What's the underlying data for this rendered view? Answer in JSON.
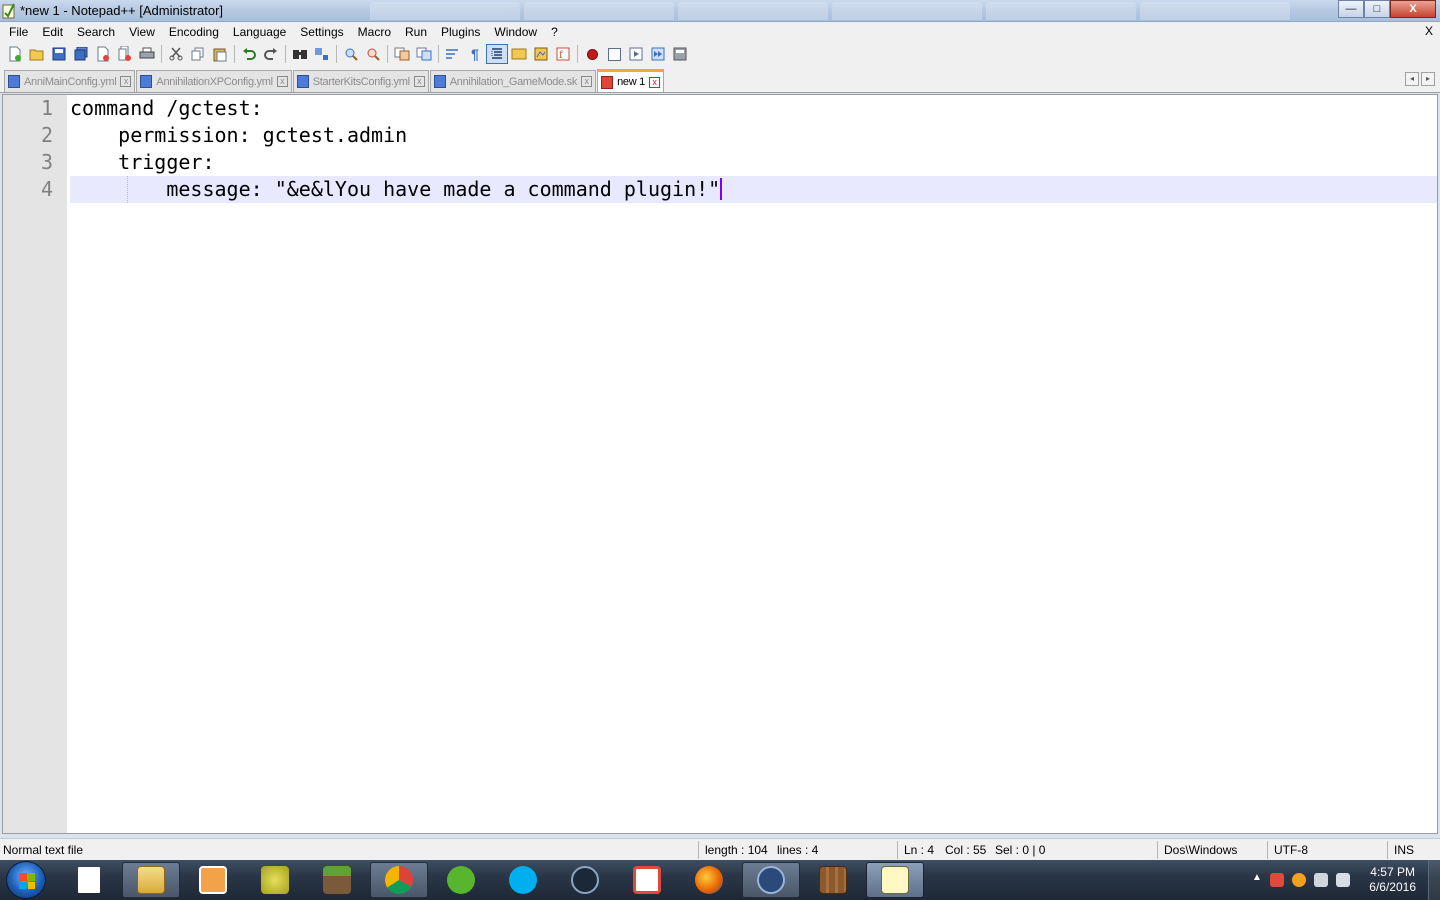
{
  "window": {
    "title": "*new 1 - Notepad++ [Administrator]",
    "minimize_label": "—",
    "maximize_label": "□",
    "close_label": "X"
  },
  "menu": {
    "items": [
      "File",
      "Edit",
      "Search",
      "View",
      "Encoding",
      "Language",
      "Settings",
      "Macro",
      "Run",
      "Plugins",
      "Window",
      "?"
    ],
    "doc_close": "X"
  },
  "toolbar": {
    "icons": [
      "new-file-icon",
      "open-file-icon",
      "save-icon",
      "save-all-icon",
      "close-icon",
      "close-all-icon",
      "print-icon",
      "cut-icon",
      "copy-icon",
      "paste-icon",
      "undo-icon",
      "redo-icon",
      "find-icon",
      "replace-icon",
      "zoom-in-icon",
      "zoom-out-icon",
      "sync-vertical-icon",
      "sync-horizontal-icon",
      "word-wrap-icon",
      "show-all-chars-icon",
      "indent-guide-icon",
      "user-language-icon",
      "doc-map-icon",
      "function-list-icon",
      "record-macro-icon",
      "stop-macro-icon",
      "play-macro-icon",
      "run-macro-multiple-icon",
      "save-macro-icon"
    ]
  },
  "tabs": [
    {
      "label": "AnniMainConfig.yml",
      "active": false
    },
    {
      "label": "AnnihilationXPConfig.yml",
      "active": false
    },
    {
      "label": "StarterKitsConfig.yml",
      "active": false
    },
    {
      "label": "Annihilation_GameMode.sk",
      "active": false
    },
    {
      "label": "new 1",
      "active": true
    }
  ],
  "tab_close_label": "x",
  "tab_nav": {
    "left": "◂",
    "right": "▸"
  },
  "editor": {
    "line_numbers": [
      "1",
      "2",
      "3",
      "4"
    ],
    "lines": [
      "command /gctest:",
      "    permission: gctest.admin",
      "    trigger:",
      "        message: \"&e&lYou have made a command plugin!\""
    ]
  },
  "status": {
    "file_type": "Normal text file",
    "length": "length : 104",
    "lines": "lines : 4",
    "ln": "Ln : 4",
    "col": "Col : 55",
    "sel": "Sel : 0 | 0",
    "eol": "Dos\\Windows",
    "encoding": "UTF-8",
    "mode": "INS"
  },
  "taskbar": {
    "pinned": [
      "file-icon",
      "explorer-icon",
      "media-player-icon",
      "sponge-block-icon",
      "minecraft-icon",
      "chrome-icon",
      "utorrent-icon",
      "skype-icon",
      "steam-icon",
      "grid-app-icon",
      "firefox-icon",
      "teamspeak-icon",
      "crafting-table-icon",
      "notepadpp-icon"
    ],
    "time": "4:57 PM",
    "date": "6/6/2016",
    "tray_arrow": "▲"
  }
}
